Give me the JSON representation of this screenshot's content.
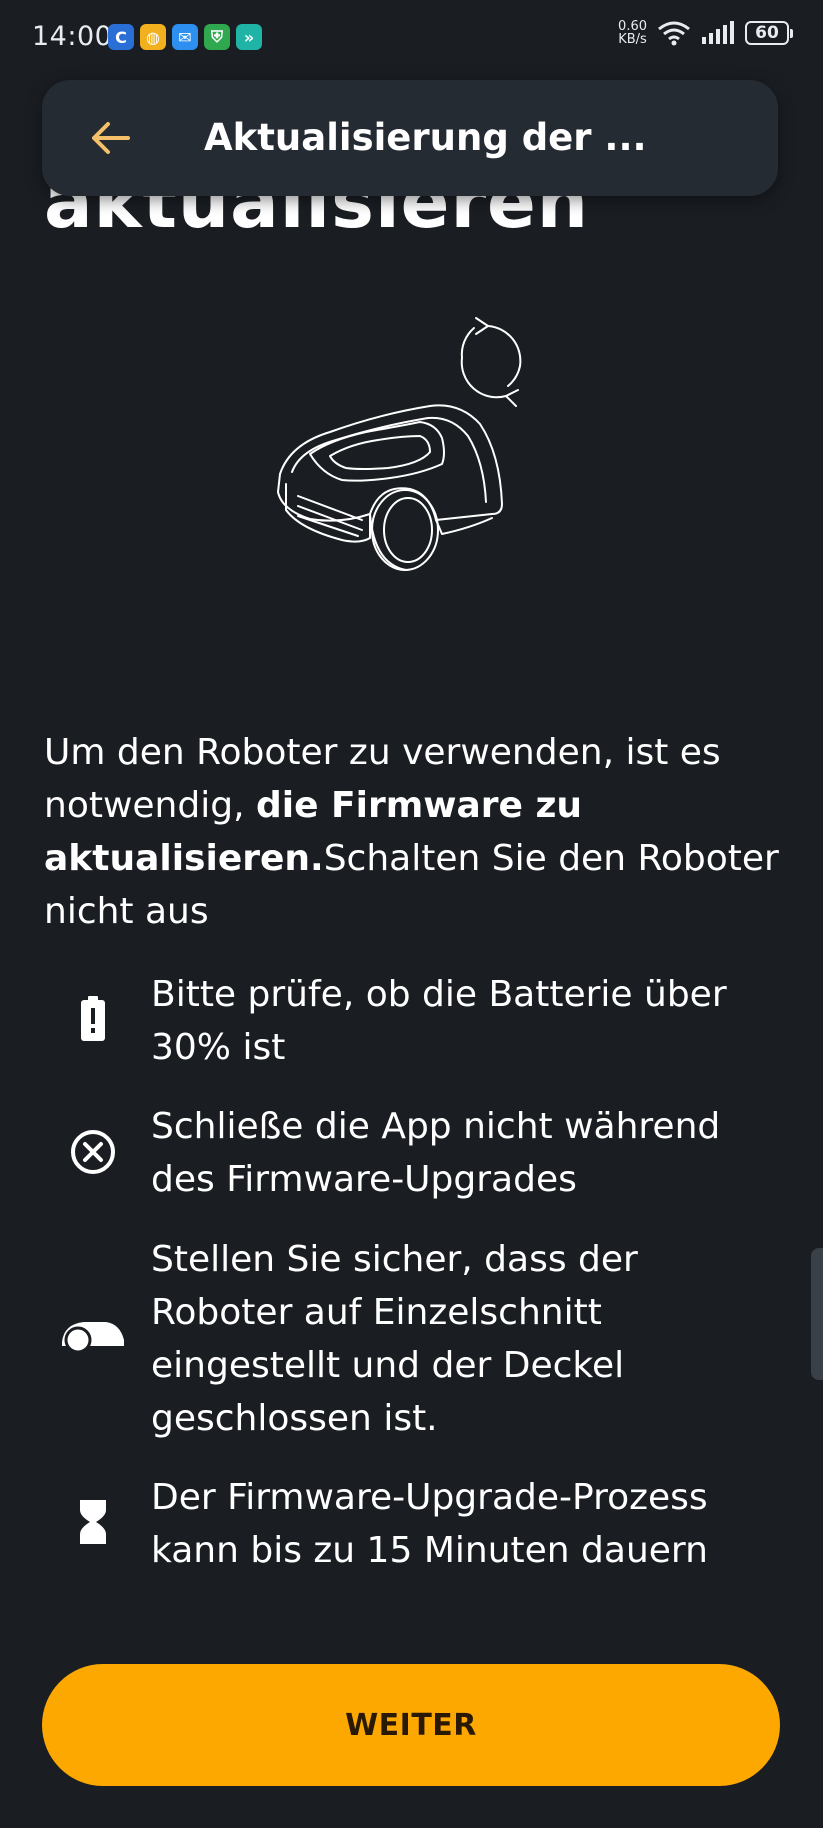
{
  "status_bar": {
    "time": "14:00",
    "net_speed_value": "0.60",
    "net_speed_unit": "KB/s",
    "battery": "60",
    "apps": [
      {
        "icon": "sync-app-icon",
        "color": "#2a6fd6",
        "glyph": "C"
      },
      {
        "icon": "globe-app-icon",
        "color": "#f2b01e",
        "glyph": "◍"
      },
      {
        "icon": "mail-app-icon",
        "color": "#2d8ff0",
        "glyph": "✉"
      },
      {
        "icon": "shield-app-icon",
        "color": "#2fa84f",
        "glyph": "⛨"
      },
      {
        "icon": "dash-app-icon",
        "color": "#1fb4a5",
        "glyph": "»"
      }
    ]
  },
  "app_bar": {
    "title": "Aktualisierung der ..."
  },
  "heading": "aktualisieren",
  "intro": {
    "part1": "Um den Roboter zu verwenden, ist es notwendig, ",
    "bold": "die Firmware zu aktualisieren.",
    "part2": "Schalten Sie den Roboter nicht aus"
  },
  "requirements": [
    {
      "icon": "battery-alert-icon",
      "line1": "Bitte prüfe, ob die Batterie über",
      "line2": "30% ist"
    },
    {
      "icon": "close-circle-icon",
      "line1": "Schließe die App nicht während",
      "line2": "des Firmware-Upgrades"
    },
    {
      "icon": "mower-icon",
      "line1": "Stellen Sie sicher, dass der",
      "line2": "Roboter auf Einzelschnitt",
      "line3": "eingestellt und der Deckel",
      "line4": "geschlossen ist."
    },
    {
      "icon": "hourglass-icon",
      "line1": "Der Firmware-Upgrade-Prozess",
      "line2": "kann bis zu 15 Minuten dauern"
    }
  ],
  "next_button": {
    "label": "WEITER"
  },
  "colors": {
    "background": "#1a1e23",
    "app_bar": "#252b32",
    "accent": "#fca800",
    "back_arrow": "#f5c06a"
  }
}
